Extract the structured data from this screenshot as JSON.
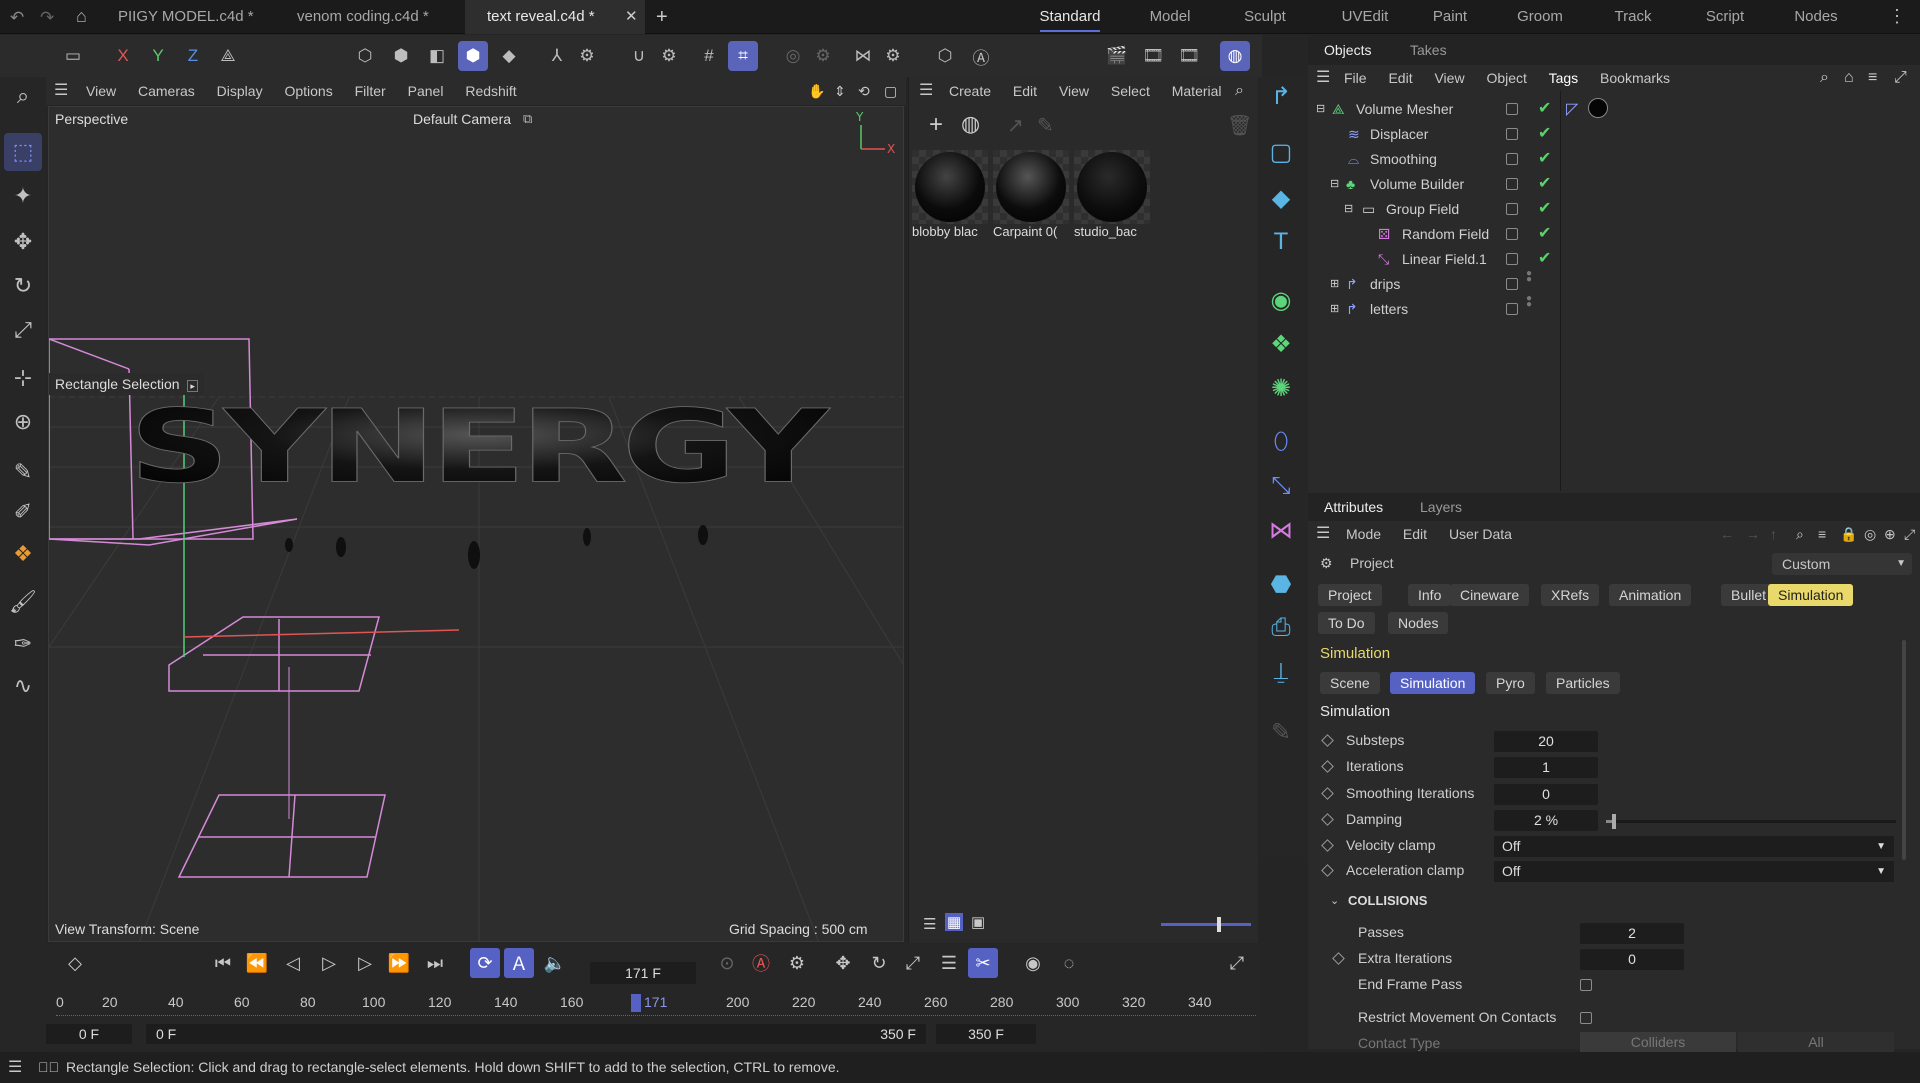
{
  "titlebar": {
    "tabs": [
      {
        "label": "PIIGY MODEL.c4d *"
      },
      {
        "label": "venom coding.c4d *"
      },
      {
        "label": "text reveal.c4d *"
      }
    ],
    "workspaces": [
      "Standard",
      "Model",
      "Sculpt",
      "UVEdit",
      "Paint",
      "Groom",
      "Track",
      "Script",
      "Nodes"
    ]
  },
  "viewport": {
    "menu": [
      "View",
      "Cameras",
      "Display",
      "Options",
      "Filter",
      "Panel",
      "Redshift"
    ],
    "mode": "Perspective",
    "camera": "Default Camera",
    "tool_label": "Rectangle Selection",
    "view_transform": "View Transform: Scene",
    "grid_spacing": "Grid Spacing : 500 cm",
    "axis_x": "X",
    "axis_y": "Y",
    "model_text": "SYNERGY"
  },
  "axes_toolbar": {
    "x": "X",
    "y": "Y",
    "z": "Z"
  },
  "materials": {
    "menu": [
      "Create",
      "Edit",
      "View",
      "Select",
      "Material"
    ],
    "items": [
      {
        "label": "blobby blac"
      },
      {
        "label": "Carpaint 0("
      },
      {
        "label": "studio_bac"
      }
    ]
  },
  "objects": {
    "tabs": [
      "Objects",
      "Takes"
    ],
    "menu": [
      "File",
      "Edit",
      "View",
      "Object",
      "Tags",
      "Bookmarks"
    ],
    "rows": [
      {
        "label": "Volume Mesher",
        "enabled": true
      },
      {
        "label": "Displacer",
        "enabled": true
      },
      {
        "label": "Smoothing",
        "enabled": true
      },
      {
        "label": "Volume Builder",
        "enabled": true
      },
      {
        "label": "Group Field",
        "enabled": true
      },
      {
        "label": "Random Field",
        "enabled": true
      },
      {
        "label": "Linear Field.1",
        "enabled": true
      },
      {
        "label": "drips",
        "enabled": false
      },
      {
        "label": "letters",
        "enabled": false
      }
    ]
  },
  "attributes": {
    "tabs": [
      "Attributes",
      "Layers"
    ],
    "menu": [
      "Mode",
      "Edit",
      "User Data"
    ],
    "object_name": "Project",
    "preset": "Custom",
    "project_tabs": [
      "Project",
      "Info",
      "Cineware",
      "XRefs",
      "Animation",
      "Bullet",
      "Simulation",
      "To Do",
      "Nodes"
    ],
    "section_title": "Simulation",
    "sub_tabs": [
      "Scene",
      "Simulation",
      "Pyro",
      "Particles"
    ],
    "group_title": "Simulation",
    "params": {
      "substeps_label": "Substeps",
      "substeps": "20",
      "iterations_label": "Iterations",
      "iterations": "1",
      "smoothing_label": "Smoothing Iterations",
      "smoothing": "0",
      "damping_label": "Damping",
      "damping": "2 %",
      "damping_fraction": 0.02,
      "velocity_label": "Velocity clamp",
      "velocity": "Off",
      "accel_label": "Acceleration clamp",
      "accel": "Off"
    },
    "collisions": {
      "title": "COLLISIONS",
      "passes_label": "Passes",
      "passes": "2",
      "extra_label": "Extra Iterations",
      "extra": "0",
      "endframe_label": "End Frame Pass",
      "restrict_label": "Restrict Movement On Contacts",
      "contact_label": "Contact Type",
      "contact_opt1": "Colliders",
      "contact_opt2": "All"
    }
  },
  "timeline": {
    "current_frame": "171 F",
    "playhead_value": 171,
    "ticks": [
      "0",
      "20",
      "40",
      "60",
      "80",
      "100",
      "120",
      "140",
      "160",
      "200",
      "220",
      "240",
      "260",
      "280",
      "300",
      "320",
      "340"
    ],
    "playhead_label": "171",
    "start_a": "0 F",
    "start_b": "0 F",
    "end_a": "350 F",
    "end_b": "350 F"
  },
  "statusbar": {
    "text": "Rectangle Selection: Click and drag to rectangle-select elements. Hold down SHIFT to add to the selection, CTRL to remove."
  },
  "colors": {
    "accent": "#5b6fd6",
    "check": "#59d36a",
    "highlight": "#e9d86a"
  }
}
